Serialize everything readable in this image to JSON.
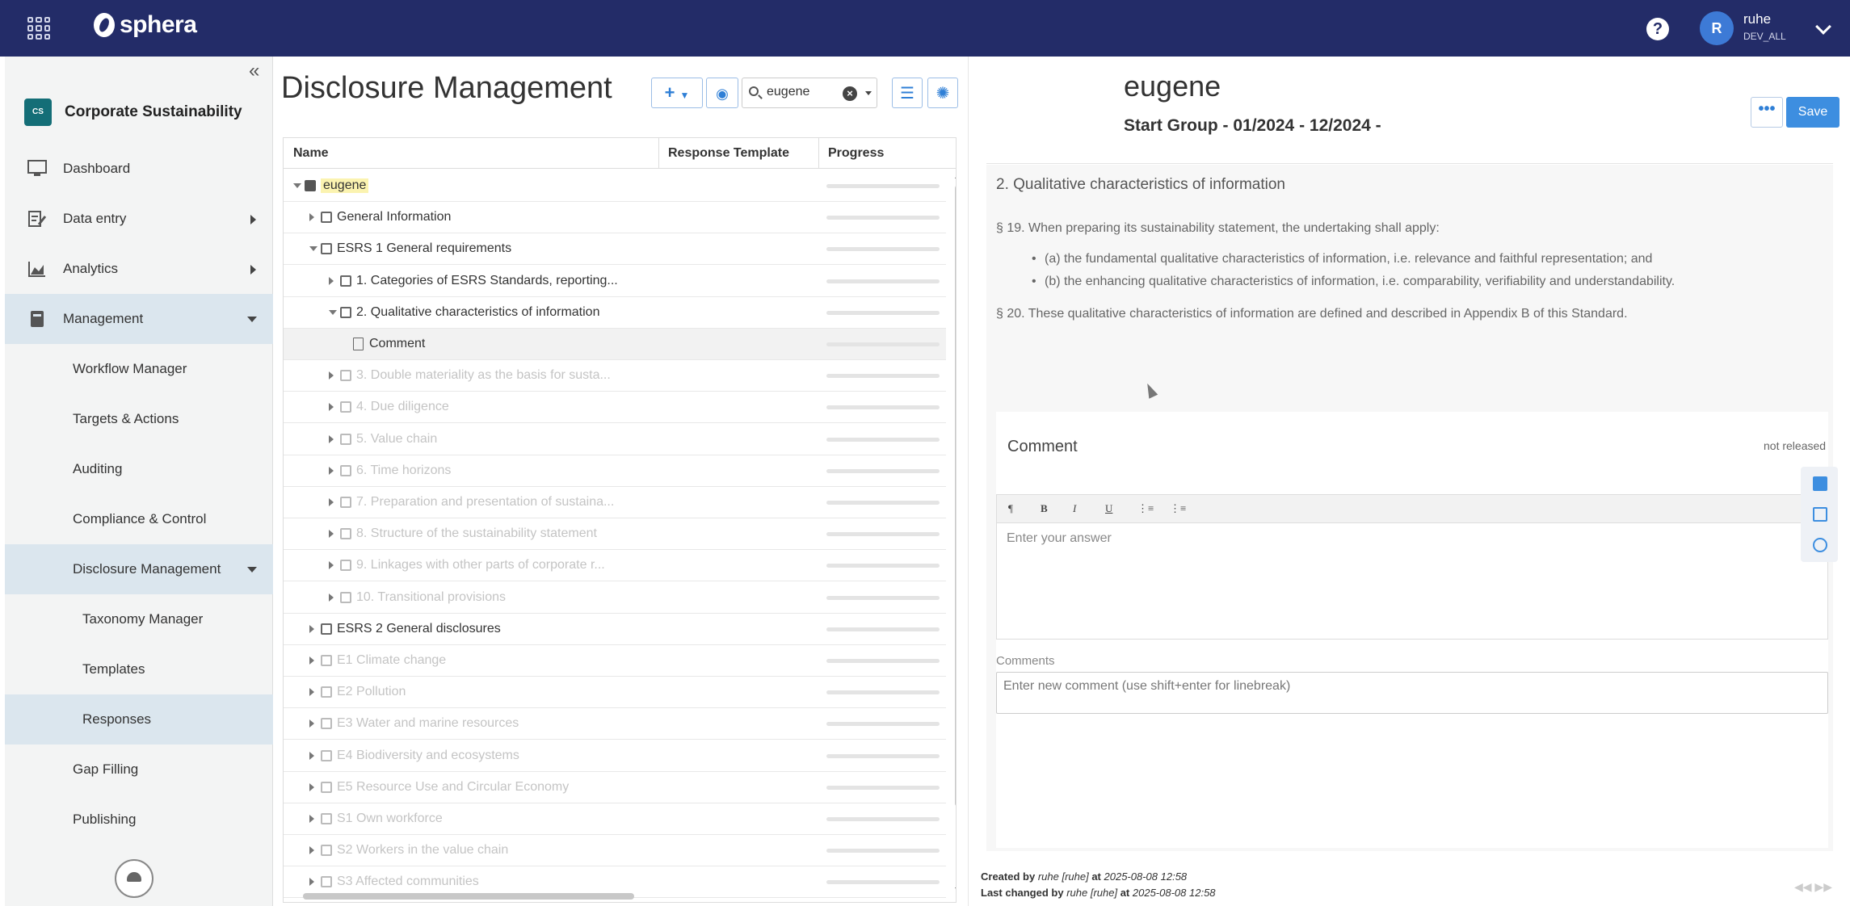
{
  "topbar": {
    "brand": "sphera",
    "help": "?",
    "user_initial": "R",
    "user_name": "ruhe",
    "user_role": "DEV_ALL"
  },
  "sidebar": {
    "collapse": "«",
    "app_badge": "CS",
    "app_name": "Corporate Sustainability",
    "items": [
      {
        "label": "Dashboard",
        "icon": "monitor-icon"
      },
      {
        "label": "Data entry",
        "icon": "data-entry-icon"
      },
      {
        "label": "Analytics",
        "icon": "analytics-icon"
      },
      {
        "label": "Management",
        "icon": "book-icon"
      }
    ],
    "management_items": [
      {
        "label": "Workflow Manager"
      },
      {
        "label": "Targets & Actions"
      },
      {
        "label": "Auditing"
      },
      {
        "label": "Compliance & Control"
      },
      {
        "label": "Disclosure Management"
      },
      {
        "label": "Taxonomy Manager"
      },
      {
        "label": "Templates"
      },
      {
        "label": "Responses"
      },
      {
        "label": "Gap Filling"
      },
      {
        "label": "Publishing"
      }
    ]
  },
  "middle": {
    "title": "Disclosure Management",
    "search_value": "eugene",
    "columns": [
      "Name",
      "Response Template",
      "Progress"
    ],
    "rows": [
      {
        "text": "eugene",
        "level": 0,
        "toggle": "down",
        "icon": "book",
        "dim": false,
        "highlight": true
      },
      {
        "text": "General Information",
        "level": 1,
        "toggle": "right",
        "icon": "folder",
        "dim": false
      },
      {
        "text": "ESRS 1 General requirements",
        "level": 1,
        "toggle": "down",
        "icon": "folder",
        "dim": false
      },
      {
        "text": "1. Categories of ESRS Standards, reporting...",
        "level": 2,
        "toggle": "right",
        "icon": "folder",
        "dim": false
      },
      {
        "text": "2. Qualitative characteristics of information",
        "level": 2,
        "toggle": "down",
        "icon": "folder",
        "dim": false
      },
      {
        "text": "Comment",
        "level": 3,
        "toggle": "none",
        "icon": "doc",
        "dim": false,
        "selected": true
      },
      {
        "text": "3. Double materiality as the basis for susta...",
        "level": 2,
        "toggle": "right",
        "icon": "folder",
        "dim": true
      },
      {
        "text": "4. Due diligence",
        "level": 2,
        "toggle": "right",
        "icon": "folder",
        "dim": true
      },
      {
        "text": "5. Value chain",
        "level": 2,
        "toggle": "right",
        "icon": "folder",
        "dim": true
      },
      {
        "text": "6. Time horizons",
        "level": 2,
        "toggle": "right",
        "icon": "folder",
        "dim": true
      },
      {
        "text": "7. Preparation and presentation of sustaina...",
        "level": 2,
        "toggle": "right",
        "icon": "folder",
        "dim": true
      },
      {
        "text": "8. Structure of the sustainability statement",
        "level": 2,
        "toggle": "right",
        "icon": "folder",
        "dim": true
      },
      {
        "text": "9. Linkages with other parts of corporate r...",
        "level": 2,
        "toggle": "right",
        "icon": "folder",
        "dim": true
      },
      {
        "text": "10. Transitional provisions",
        "level": 2,
        "toggle": "right",
        "icon": "folder",
        "dim": true
      },
      {
        "text": "ESRS 2 General disclosures",
        "level": 1,
        "toggle": "right",
        "icon": "folder",
        "dim": false
      },
      {
        "text": "E1 Climate change",
        "level": 1,
        "toggle": "right",
        "icon": "folder",
        "dim": true
      },
      {
        "text": "E2 Pollution",
        "level": 1,
        "toggle": "right",
        "icon": "folder",
        "dim": true
      },
      {
        "text": "E3 Water and marine resources",
        "level": 1,
        "toggle": "right",
        "icon": "folder",
        "dim": true
      },
      {
        "text": "E4 Biodiversity and ecosystems",
        "level": 1,
        "toggle": "right",
        "icon": "folder",
        "dim": true
      },
      {
        "text": "E5 Resource Use and Circular Economy",
        "level": 1,
        "toggle": "right",
        "icon": "folder",
        "dim": true
      },
      {
        "text": "S1 Own workforce",
        "level": 1,
        "toggle": "right",
        "icon": "folder",
        "dim": true
      },
      {
        "text": "S2 Workers in the value chain",
        "level": 1,
        "toggle": "right",
        "icon": "folder",
        "dim": true
      },
      {
        "text": "S3 Affected communities",
        "level": 1,
        "toggle": "right",
        "icon": "folder",
        "dim": true
      }
    ]
  },
  "right": {
    "title": "eugene",
    "subtitle": "Start Group - 01/2024 - 12/2024 -",
    "more_label": "•••",
    "save_label": "Save",
    "section_heading": "2. Qualitative characteristics of information",
    "para1": "§ 19. When preparing its sustainability statement, the undertaking shall apply:",
    "bullet_a": "(a) the fundamental qualitative characteristics of information, i.e. relevance and faithful representation; and",
    "bullet_b": "(b) the enhancing qualitative characteristics of information, i.e. comparability, verifiability and understandability.",
    "para2": "§ 20. These qualitative characteristics of information are defined and described in Appendix B of this Standard.",
    "comment_title": "Comment",
    "comment_status": "not released",
    "editor_placeholder": "Enter your answer",
    "comments_label": "Comments",
    "comments_placeholder": "Enter new comment (use shift+enter for linebreak)",
    "created_label": "Created by",
    "created_user": "ruhe [ruhe]",
    "created_at_label": "at",
    "created_time": "2025-08-08 12:58",
    "changed_label": "Last changed by",
    "changed_user": "ruhe [ruhe]",
    "changed_at_label": "at",
    "changed_time": "2025-08-08 12:58"
  }
}
